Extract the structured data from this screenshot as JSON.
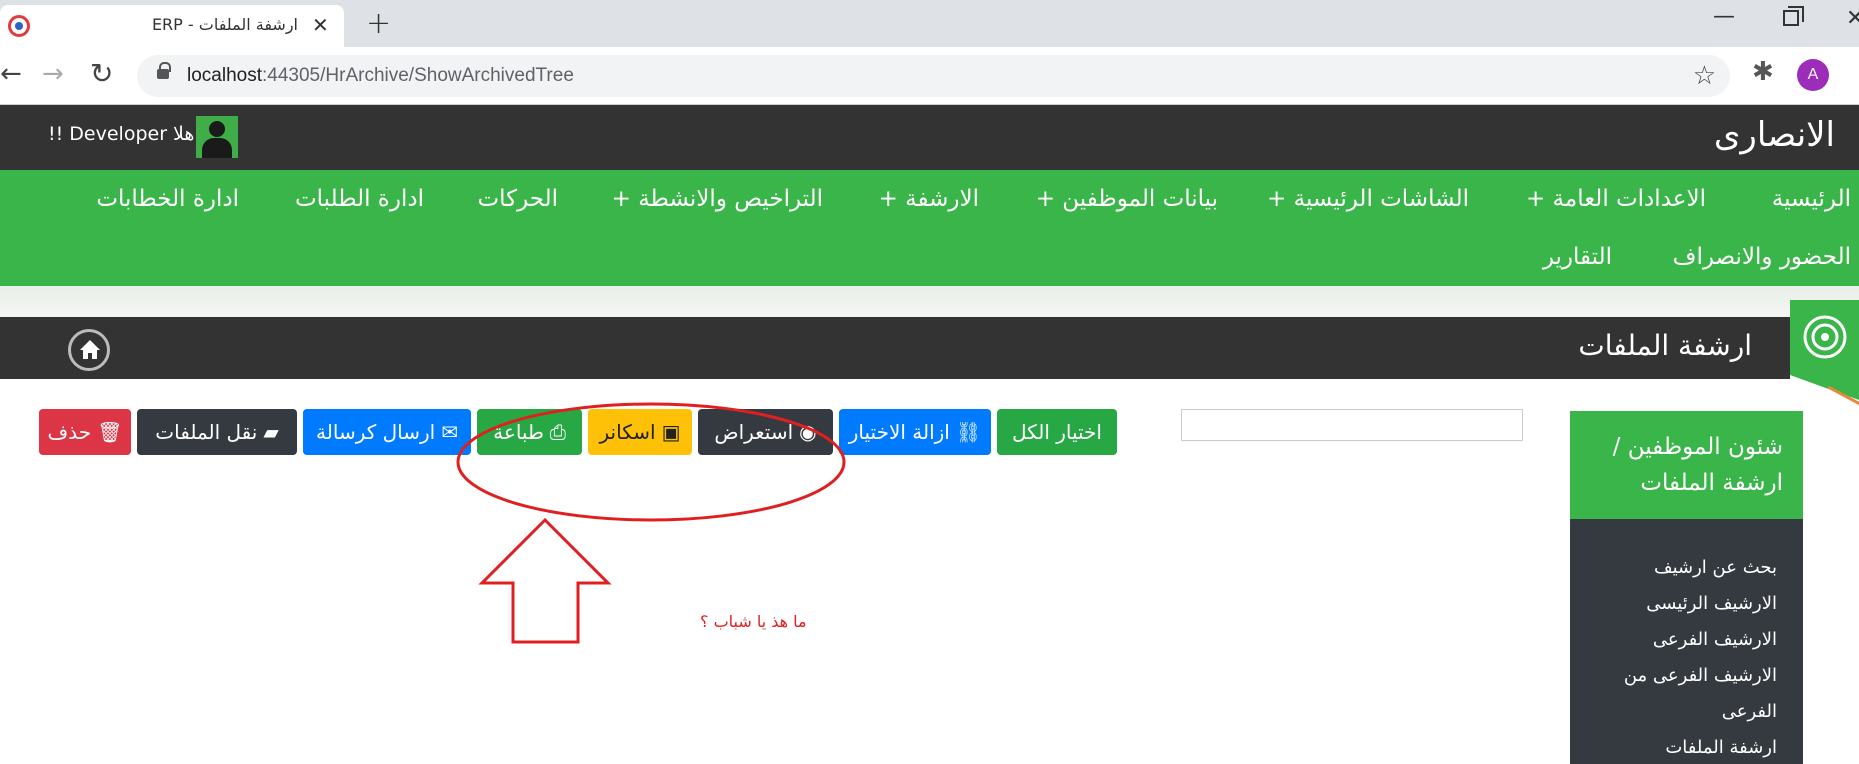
{
  "browser": {
    "tab_title": "ارشفة الملفات - ERP",
    "close_glyph": "✕",
    "new_tab_glyph": "+",
    "url_host": "localhost",
    "url_rest": ":44305/HrArchive/ShowArchivedTree",
    "profile_initial": "A",
    "minimize_glyph": "—",
    "close_window_glyph": "✕",
    "back_glyph": "←",
    "forward_glyph": "→",
    "reload_glyph": "↻",
    "star_glyph": "☆",
    "extensions_glyph": "✱"
  },
  "header": {
    "brand": "الانصارى",
    "greeting": "اهلا Developer !!"
  },
  "nav": {
    "items": [
      "الرئيسية",
      "الاعدادات العامة +",
      "الشاشات الرئيسية +",
      "بيانات الموظفين +",
      "الارشفة +",
      "التراخيص والانشطة +",
      "الحركات",
      "ادارة الطلبات",
      "ادارة الخطابات",
      "الحضور والانصراف",
      "التقارير"
    ]
  },
  "page": {
    "title": "ارشفة الملفات"
  },
  "toolbar": {
    "select_all": "اختيار الكل",
    "deselect": "ازالة الاختيار",
    "preview": "استعراض",
    "scanner": "اسكانر",
    "print": "طباعة",
    "send_message": "ارسال كرسالة",
    "move_files": "نقل الملفات",
    "delete": "حذف"
  },
  "search": {
    "value": ""
  },
  "sidebar": {
    "heading": "شئون الموظفين / ارشفة الملفات",
    "items": [
      "بحث عن ارشيف",
      "الارشيف الرئيسى",
      "الارشيف الفرعى",
      "الارشيف الفرعى من",
      "الفرعى",
      "ارشفة الملفات"
    ]
  },
  "annotation": {
    "text": "ما هذ يا شباب ؟"
  },
  "colors": {
    "green": "#3ab54a",
    "dark": "#333333",
    "annotation_red": "#e02020"
  }
}
